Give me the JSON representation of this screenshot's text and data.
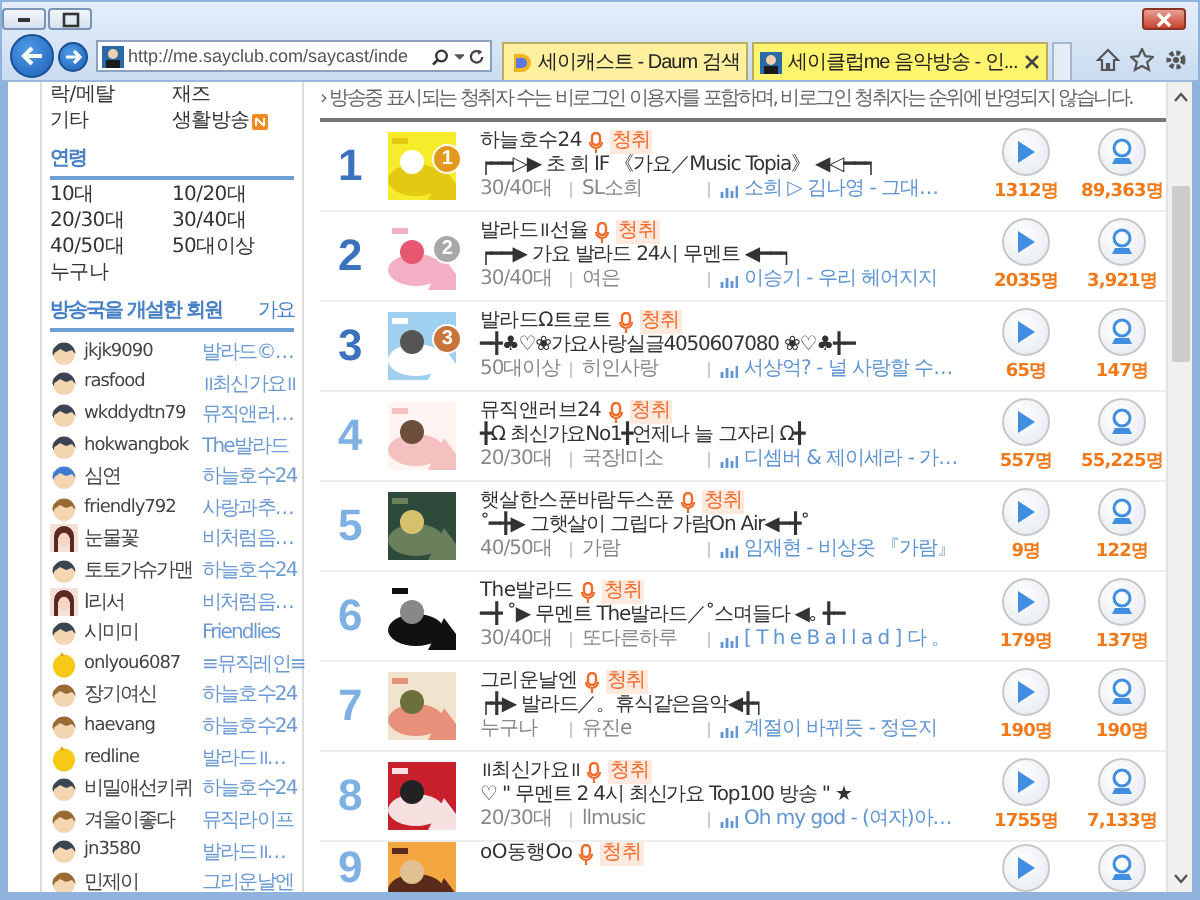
{
  "browser": {
    "address": "http://me.sayclub.com/saycast/inde",
    "tabs": [
      {
        "title": "세이캐스트 - Daum 검색",
        "selected": false
      },
      {
        "title": "세이클럽me 음악방송 - 인...",
        "selected": true
      }
    ]
  },
  "sidebar": {
    "genres": [
      {
        "label": "락/메탈",
        "new": false
      },
      {
        "label": "재즈",
        "new": false
      },
      {
        "label": "기타",
        "new": false
      },
      {
        "label": "생활방송",
        "new": true
      }
    ],
    "age_heading": "연령",
    "ages": [
      "10대",
      "10/20대",
      "20/30대",
      "30/40대",
      "40/50대",
      "50대이상",
      "누구나"
    ],
    "members_heading": "방송국을 개설한 회원",
    "members_filter": "가요",
    "members": [
      {
        "name": "jkjk9090",
        "station": "발라드©…",
        "kind": "dark"
      },
      {
        "name": "rasfood",
        "station": "॥최신가요॥",
        "kind": "dark"
      },
      {
        "name": "wkddydtn79",
        "station": "뮤직앤러…",
        "kind": "dark"
      },
      {
        "name": "hokwangbok",
        "station": "The발라드",
        "kind": "dark"
      },
      {
        "name": "심연",
        "station": "하늘호수24",
        "kind": "blue"
      },
      {
        "name": "friendly792",
        "station": "사랑과추…",
        "kind": "brown"
      },
      {
        "name": "눈물꽃",
        "station": "비처럼음…",
        "kind": "girl"
      },
      {
        "name": "토토가슈가맨",
        "station": "하늘호수24",
        "kind": "dark"
      },
      {
        "name": "l리서",
        "station": "비처럼음…",
        "kind": "girl"
      },
      {
        "name": "시미미",
        "station": "Friendlies",
        "kind": "dark"
      },
      {
        "name": "onlyou6087",
        "station": "≡뮤직레인≡",
        "kind": "chick"
      },
      {
        "name": "장기여신",
        "station": "하늘호수24",
        "kind": "brown"
      },
      {
        "name": "haevang",
        "station": "하늘호수24",
        "kind": "brown"
      },
      {
        "name": "redline",
        "station": "발라드॥…",
        "kind": "chick"
      },
      {
        "name": "비밀애선키퀴",
        "station": "하늘호수24",
        "kind": "dark"
      },
      {
        "name": "겨울이좋다",
        "station": "뮤직라이프",
        "kind": "brown"
      },
      {
        "name": "jn3580",
        "station": "발라드॥…",
        "kind": "dark"
      },
      {
        "name": "민제이",
        "station": "그리운날엔",
        "kind": "brown"
      }
    ]
  },
  "notice": "› 방송중 표시되는 청취자 수는 비로그인 이용자를 포함하며, 비로그인 청취자는 순위에 반영되지 않습니다.",
  "stations": [
    {
      "rank": "1",
      "top": true,
      "medal": {
        "label": "1",
        "color": "#e39a1c"
      },
      "title": "하늘호수24",
      "on_air": "청취",
      "tagline": "┍━━▷▶ 초 희 IF 《가요／Music Topia》 ◀◁━━┑",
      "age": "30/40대",
      "dj": "SL소희",
      "song": "소희 ▷ 김나영 - 그대…",
      "listeners": "1312명",
      "total": "89,363명"
    },
    {
      "rank": "2",
      "top": true,
      "medal": {
        "label": "2",
        "color": "#a8a8a8"
      },
      "title": "발라드॥선율",
      "on_air": "청취",
      "tagline": "┍━━▶ 가요 발라드 24시 무멘트 ◀━━┑",
      "age": "30/40대",
      "dj": "여은",
      "song": "이승기 - 우리 헤어지지",
      "listeners": "2035명",
      "total": "3,921명"
    },
    {
      "rank": "3",
      "top": true,
      "medal": {
        "label": "3",
        "color": "#c8743a"
      },
      "title": "발라드Ω트로트",
      "on_air": "청취",
      "tagline": "━╋♣♡❀가요사랑실글4050607080 ❀♡♣╋━",
      "age": "50대이상",
      "dj": "히인사랑",
      "song": "서상억? - 널 사랑할 수…",
      "listeners": "65명",
      "total": "147명"
    },
    {
      "rank": "4",
      "top": false,
      "title": "뮤직앤러브24",
      "on_air": "청취",
      "tagline": "╋Ω 최신가요No1╋언제나 늘 그자리 Ω╋",
      "age": "20/30대",
      "dj": "국장l미소",
      "song": "디셈버 & 제이세라 - 가…",
      "listeners": "557명",
      "total": "55,225명"
    },
    {
      "rank": "5",
      "top": false,
      "title": "햇살한스푼바람두스푼",
      "on_air": "청취",
      "tagline": "˚━╋▶ 그햇살이 그립다 가람On Air◀━╋˚",
      "age": "40/50대",
      "dj": "가람",
      "song": "임재현 - 비상옷 『가람』",
      "listeners": "9명",
      "total": "122명"
    },
    {
      "rank": "6",
      "top": false,
      "title": "The발라드",
      "on_air": "청취",
      "tagline": "━╋ ˚▶ 무멘트 The발라드／˚스며들다 ◀｡ ╋━",
      "age": "30/40대",
      "dj": "또다른하루",
      "song": "[ T h e B a l l a d ] 다 。",
      "listeners": "179명",
      "total": "137명"
    },
    {
      "rank": "7",
      "top": false,
      "title": "그리운날엔",
      "on_air": "청취",
      "tagline": "┍╋▶ 발라드／。휴식같은음악◀╋┑",
      "age": "누구나",
      "dj": "유진e",
      "song": "계절이 바뀌듯 - 정은지",
      "listeners": "190명",
      "total": "190명"
    },
    {
      "rank": "8",
      "top": false,
      "title": "॥최신가요॥",
      "on_air": "청취",
      "tagline": "♡ \" 무멘트 2 4시 최신가요 Top100 방송 \" ★",
      "age": "20/30대",
      "dj": "llmusic",
      "song": "Oh my god - (여자)아…",
      "listeners": "1755명",
      "total": "7,133명"
    },
    {
      "rank": "9",
      "top": false,
      "title": "oO동행Oo",
      "on_air": "청취"
    }
  ]
}
